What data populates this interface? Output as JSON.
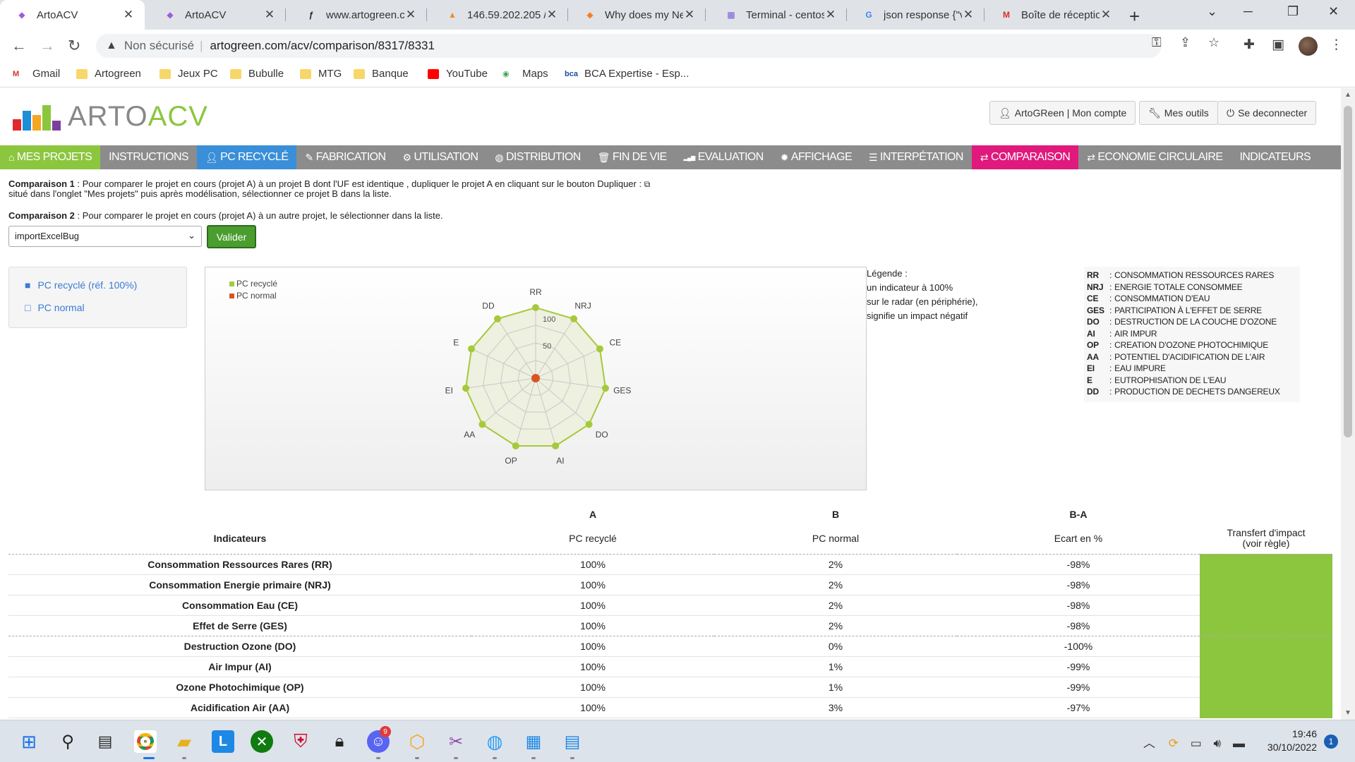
{
  "browser": {
    "tabs": [
      {
        "title": "ArtoACV",
        "icon": "artoacv-favicon",
        "active": true
      },
      {
        "title": "ArtoACV",
        "icon": "artoacv-favicon"
      },
      {
        "title": "www.artogreen.c",
        "icon": "symfony-favicon"
      },
      {
        "title": "146.59.202.205 / l",
        "icon": "phpmyadmin-favicon"
      },
      {
        "title": "Why does my Ne",
        "icon": "stackoverflow-favicon"
      },
      {
        "title": "Terminal - centos",
        "icon": "terminal-favicon"
      },
      {
        "title": "json response {\"v",
        "icon": "google-favicon"
      },
      {
        "title": "Boîte de réceptio",
        "icon": "gmail-favicon"
      }
    ],
    "not_secure": "Non sécurisé",
    "url": "artogreen.com/acv/comparison/8317/8331",
    "bookmarks": [
      "Gmail",
      "Artogreen",
      "Jeux PC",
      "Bubulle",
      "MTG",
      "Banque",
      "YouTube",
      "Maps",
      "BCA Expertise - Esp..."
    ]
  },
  "app": {
    "logo_left": "ARTO",
    "logo_right": "ACV",
    "account_button": "ArtoGReen | Mon compte",
    "tools_button": "Mes outils",
    "logout_button": "Se deconnecter",
    "menu": [
      {
        "label": "MES PROJETS",
        "icon": "home-icon",
        "style": "green"
      },
      {
        "label": "INSTRUCTIONS",
        "icon": "",
        "style": "gray"
      },
      {
        "label": "PC RECYCLÉ",
        "icon": "user-icon",
        "style": "blue"
      },
      {
        "label": "FABRICATION",
        "icon": "wrench-icon",
        "style": "gray"
      },
      {
        "label": "UTILISATION",
        "icon": "gear-icon",
        "style": "gray"
      },
      {
        "label": "DISTRIBUTION",
        "icon": "globe-icon",
        "style": "gray"
      },
      {
        "label": "FIN DE VIE",
        "icon": "trash-icon",
        "style": "gray"
      },
      {
        "label": "EVALUATION",
        "icon": "signal-icon",
        "style": "gray"
      },
      {
        "label": "AFFICHAGE",
        "icon": "cog-icon",
        "style": "gray"
      },
      {
        "label": "INTERPÉTATION",
        "icon": "list-icon",
        "style": "gray"
      },
      {
        "label": "COMPARAISON",
        "icon": "exchange-icon",
        "style": "pink"
      },
      {
        "label": "ECONOMIE CIRCULAIRE",
        "icon": "exchange-icon",
        "style": "gray"
      },
      {
        "label": "INDICATEURS",
        "icon": "",
        "style": "gray"
      }
    ],
    "comparison1_label": "Comparaison 1",
    "comparison1_text": " : Pour comparer le projet en cours (projet A) à un projet B dont l'UF est identique , dupliquer le projet A en cliquant sur le bouton Dupliquer :",
    "comparison1_text2": "situé dans l'onglet \"Mes projets\" puis après modélisation, sélectionner ce projet B dans la liste.",
    "comparison2_label": "Comparaison 2",
    "comparison2_text": " : Pour comparer le projet en cours (projet A) à un autre projet, le sélectionner dans la liste.",
    "select_value": "importExcelBug",
    "validate_button": "Valider",
    "projects": [
      {
        "label": "PC recyclé (réf. 100%)",
        "icon": "folder-filled-icon"
      },
      {
        "label": "PC normal",
        "icon": "folder-open-icon"
      }
    ],
    "legend_title": "Légende :",
    "legend_lines": [
      "un indicateur à 100%",
      "sur le radar (en périphérie),",
      "signifie un impact négatif"
    ],
    "abbreviations": [
      {
        "k": "RR",
        "v": "CONSOMMATION RESSOURCES RARES"
      },
      {
        "k": "NRJ",
        "v": "ENERGIE TOTALE CONSOMMEE"
      },
      {
        "k": "CE",
        "v": "CONSOMMATION D'EAU"
      },
      {
        "k": "GES",
        "v": "PARTICIPATION À L'EFFET DE SERRE"
      },
      {
        "k": "DO",
        "v": "DESTRUCTION DE LA COUCHE D'OZONE"
      },
      {
        "k": "AI",
        "v": "AIR IMPUR"
      },
      {
        "k": "OP",
        "v": "CREATION D'OZONE PHOTOCHIMIQUE"
      },
      {
        "k": "AA",
        "v": "POTENTIEL D'ACIDIFICATION DE L'AIR"
      },
      {
        "k": "EI",
        "v": "EAU IMPURE"
      },
      {
        "k": "E",
        "v": "EUTROPHISATION DE L'EAU"
      },
      {
        "k": "DD",
        "v": "PRODUCTION DE DECHETS DANGEREUX"
      }
    ],
    "table": {
      "group_headers": [
        "",
        "A",
        "B",
        "B-A",
        ""
      ],
      "headers": [
        "Indicateurs",
        "PC recyclé",
        "PC normal",
        "Ecart en %",
        "Transfert d'impact",
        "(voir règle)"
      ],
      "rows": [
        {
          "name": "Consommation Ressources Rares (RR)",
          "a": "100%",
          "b": "2%",
          "ba": "-98%"
        },
        {
          "name": "Consommation Energie primaire (NRJ)",
          "a": "100%",
          "b": "2%",
          "ba": "-98%"
        },
        {
          "name": "Consommation Eau (CE)",
          "a": "100%",
          "b": "2%",
          "ba": "-98%"
        },
        {
          "name": "Effet de Serre (GES)",
          "a": "100%",
          "b": "2%",
          "ba": "-98%"
        },
        {
          "name": "Destruction Ozone (DO)",
          "a": "100%",
          "b": "0%",
          "ba": "-100%"
        },
        {
          "name": "Air Impur (AI)",
          "a": "100%",
          "b": "1%",
          "ba": "-99%"
        },
        {
          "name": "Ozone Photochimique (OP)",
          "a": "100%",
          "b": "1%",
          "ba": "-99%"
        },
        {
          "name": "Acidification Air (AA)",
          "a": "100%",
          "b": "3%",
          "ba": "-97%"
        }
      ]
    }
  },
  "chart_data": {
    "type": "radar",
    "categories": [
      "RR",
      "NRJ",
      "CE",
      "GES",
      "DO",
      "AI",
      "OP",
      "AA",
      "EI",
      "E",
      "DD"
    ],
    "series": [
      {
        "name": "PC recyclé",
        "color": "#a5c93a",
        "values": [
          100,
          100,
          100,
          100,
          100,
          100,
          100,
          100,
          100,
          100,
          100
        ]
      },
      {
        "name": "PC normal",
        "color": "#d9541e",
        "values": [
          2,
          2,
          2,
          2,
          0,
          1,
          1,
          3,
          2,
          2,
          2
        ]
      }
    ],
    "tick_labels": [
      "50",
      "100"
    ],
    "range": [
      0,
      100
    ],
    "legend_position": "top-left"
  },
  "taskbar": {
    "time": "19:46",
    "date": "30/10/2022",
    "notifications": "1",
    "discord_badge": "9"
  }
}
